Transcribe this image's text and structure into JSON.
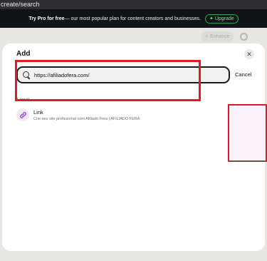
{
  "browser": {
    "url_fragment": "create/search"
  },
  "promo": {
    "strong": "Try Pro for free",
    "text": " — our most popular plan for content creators and businesses.",
    "upgrade_label": "Upgrade",
    "upgrade_icon": "sparkle-icon"
  },
  "page": {
    "enhance_label": "Enhance",
    "enhance_icon": "sparkle-icon",
    "settings_icon": "gear-icon"
  },
  "modal": {
    "title": "Add",
    "close_icon": "close-icon",
    "search_value": "https://afiliadofera.com/",
    "search_icon": "search-icon",
    "cancel_label": "Cancel",
    "result_count": "1 result",
    "results": [
      {
        "title": "Link",
        "subtitle": "Crie seu site profissional com Afiliado Fera | AFILIADO FERA",
        "icon": "link-icon",
        "action_icon": "chevron-right-icon"
      }
    ]
  },
  "colors": {
    "accent_green": "#2fa55a",
    "link_icon_purple": "#8b3fd1",
    "highlight_red": "#e11b22"
  }
}
